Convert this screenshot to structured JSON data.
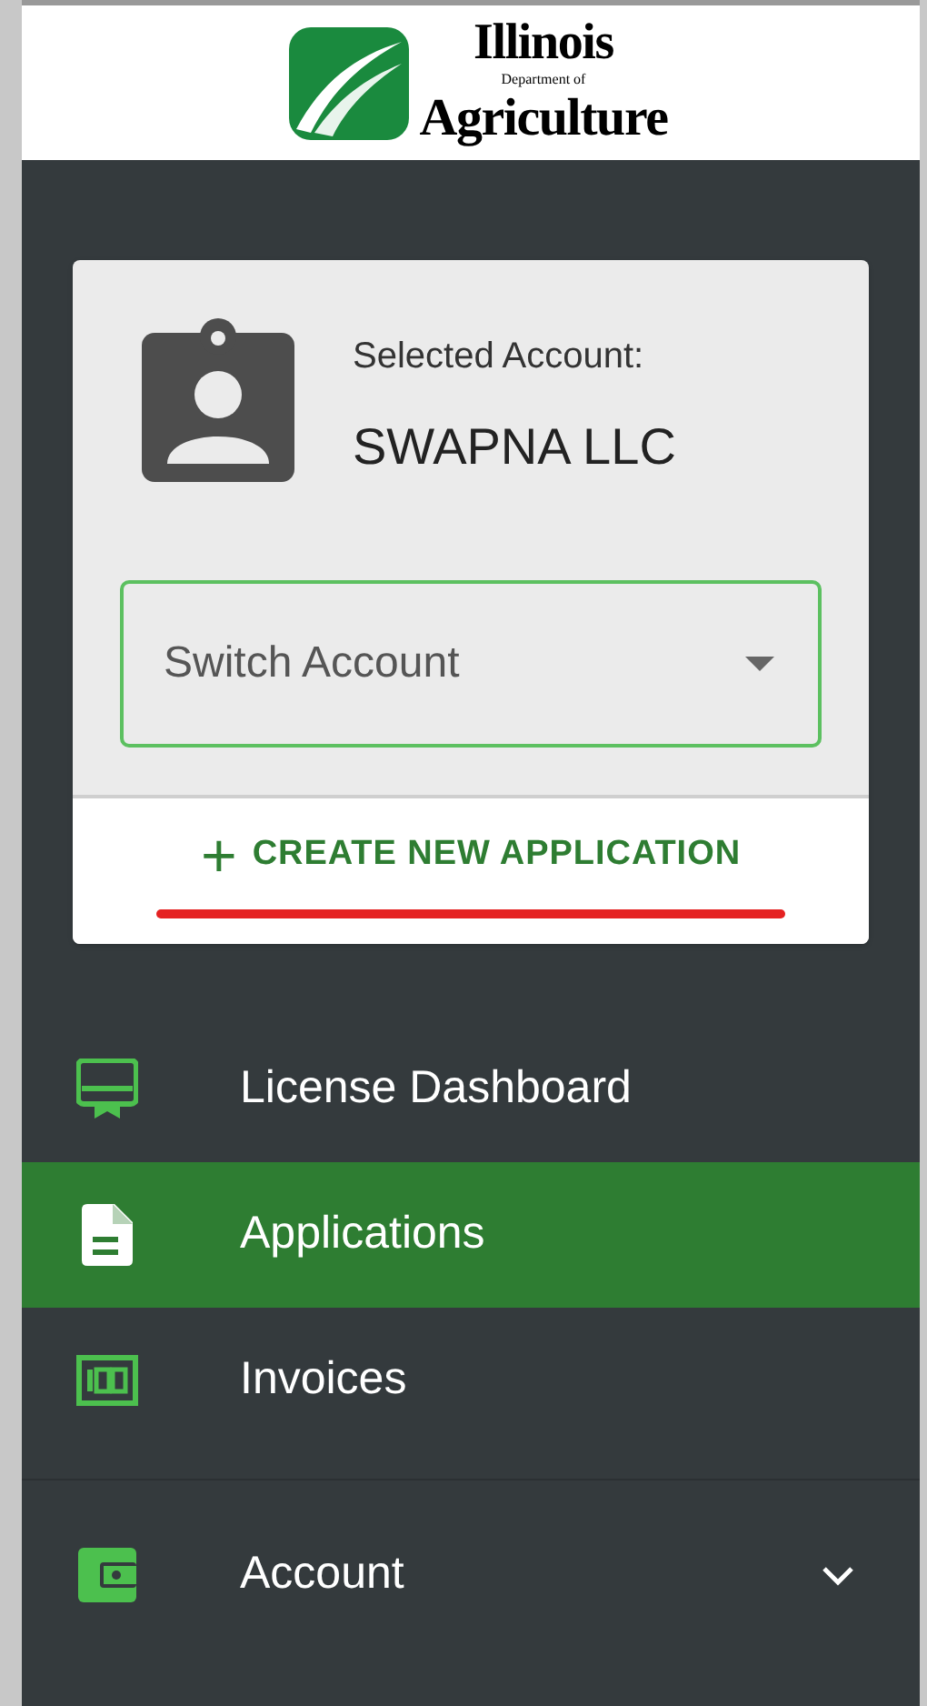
{
  "logo": {
    "line_1": "Illinois",
    "line_2": "Department of",
    "line_3": "Agriculture"
  },
  "account_card": {
    "label": "Selected Account:",
    "name": "SWAPNA LLC",
    "switch_field": {
      "placeholder": "Switch Account"
    },
    "create_button": {
      "icon": "+",
      "label": "CREATE NEW APPLICATION"
    }
  },
  "nav_items": [
    {
      "kind": "license",
      "label": "License Dashboard",
      "selected": false
    },
    {
      "kind": "document",
      "label": "Applications",
      "selected": true
    },
    {
      "kind": "invoice",
      "label": "Invoices",
      "selected": false
    },
    {
      "kind": "wallet",
      "label": "Account",
      "selected": false,
      "expandable": true,
      "divider_before": true
    }
  ]
}
